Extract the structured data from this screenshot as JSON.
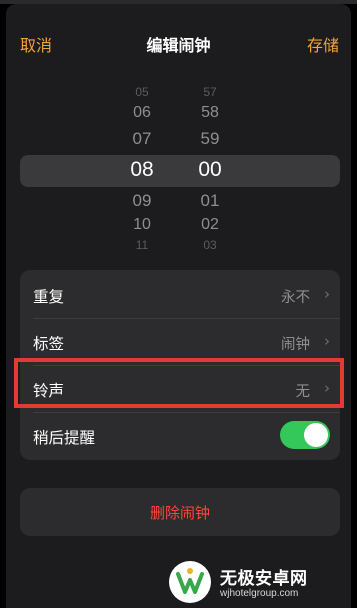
{
  "header": {
    "cancel_label": "取消",
    "title": "编辑闹钟",
    "save_label": "存储"
  },
  "picker": {
    "hours": [
      "05",
      "06",
      "07",
      "08",
      "09",
      "10",
      "11"
    ],
    "minutes": [
      "57",
      "58",
      "59",
      "00",
      "01",
      "02",
      "03"
    ],
    "selected_hour": "08",
    "selected_minute": "00"
  },
  "settings": {
    "repeat": {
      "label": "重复",
      "value": "永不"
    },
    "label": {
      "label": "标签",
      "value": "闹钟"
    },
    "sound": {
      "label": "铃声",
      "value": "无"
    },
    "snooze": {
      "label": "稍后提醒",
      "enabled": true
    }
  },
  "delete_label": "删除闹钟",
  "watermark": {
    "text": "无极安卓网",
    "url": "wjhotelgroup.com"
  },
  "colors": {
    "accent": "#f1a33c",
    "toggle_on": "#34c759",
    "destructive": "#ff453a",
    "highlight_box": "#e53935"
  }
}
